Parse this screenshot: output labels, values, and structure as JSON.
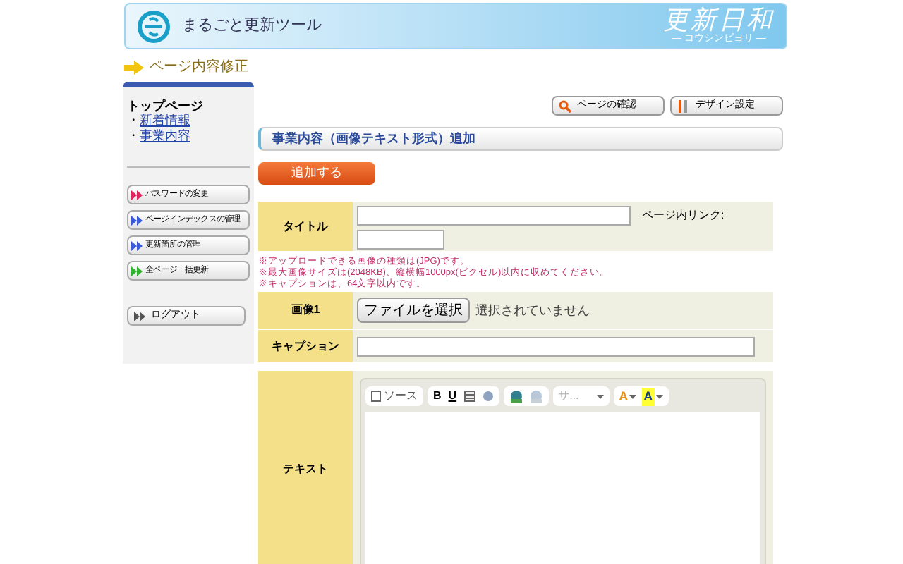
{
  "header": {
    "app_name": "まるごと更新ツール",
    "brand": "更新日和",
    "brand_sub": "― コウシンビヨリ ―"
  },
  "breadcrumb": "ページ内容修正",
  "sidebar": {
    "top_link": "トップページ",
    "links": [
      {
        "marker": "・",
        "label": "新着情報"
      },
      {
        "marker": "・",
        "label": "事業内容"
      }
    ],
    "buttons": [
      {
        "label": "パスワードの変更",
        "color": "#e0245e"
      },
      {
        "label": "ページインデックスの管理",
        "color": "#3b5bdb"
      },
      {
        "label": "更新箇所の管理",
        "color": "#3b5bdb"
      },
      {
        "label": "全ページ一括更新",
        "color": "#2fb32f"
      }
    ],
    "logout": {
      "label": "ログアウト",
      "color": "#555555"
    }
  },
  "top_buttons": [
    {
      "kind": "search",
      "label": "ページの確認"
    },
    {
      "kind": "design",
      "label": "デザイン設定"
    }
  ],
  "section_title": "事業内容（画像テキスト形式）追加",
  "add_button": "追加する",
  "form": {
    "title_label": "タイトル",
    "anchor_label": "ページ内リンク:",
    "notes": [
      "※アップロードできる画像の種類は(JPG)です。",
      "※最大画像サイズは(2048KB)、縦横幅1000px(ピクセル)以内に収めてください。",
      "※キャプションは、64文字以内です。"
    ],
    "image_label": "画像1",
    "file_button": "ファイルを選択",
    "file_status": "選択されていません",
    "caption_label": "キャプション",
    "text_label": "テキスト",
    "editor_toolbar": {
      "source": "ソース",
      "bold": "B",
      "underline": "U",
      "style_menu": "サ...",
      "font_color": "A",
      "bg_color": "A"
    }
  }
}
